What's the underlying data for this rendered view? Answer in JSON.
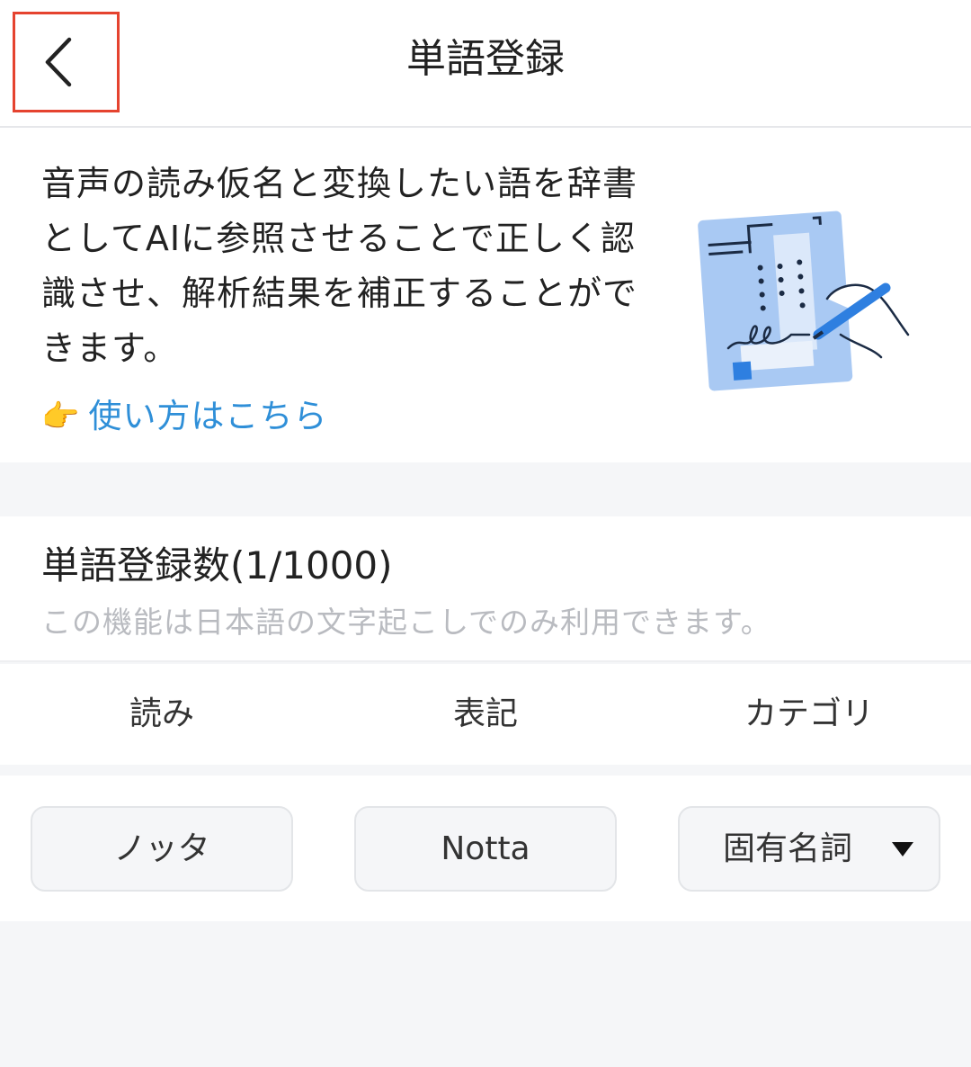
{
  "header": {
    "title": "単語登録",
    "back_icon": "chevron-left-icon",
    "highlight_color": "#e5432f"
  },
  "intro": {
    "text": "音声の読み仮名と変換したい語を辞書としてAIに参照させることで正しく認識させ、解析結果を補正することができます。",
    "howto_icon": "👉",
    "howto_label": "使い方はこちら",
    "link_color": "#2f8fd8",
    "illustration": "dictionary-writing-illustration"
  },
  "word_count": {
    "title": "単語登録数(1/1000)",
    "note": "この機能は日本語の文字起こしでのみ利用できます。"
  },
  "table": {
    "headers": [
      "読み",
      "表記",
      "カテゴリ"
    ],
    "rows": [
      {
        "reading": "ノッタ",
        "notation": "Notta",
        "category": "固有名詞"
      }
    ]
  }
}
